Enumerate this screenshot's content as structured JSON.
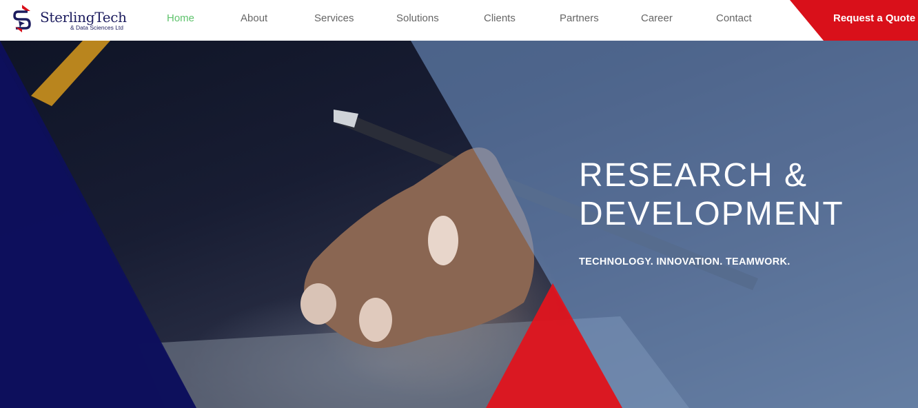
{
  "brand": {
    "name": "SterlingTech",
    "subtitle": "& Data Sciences Ltd"
  },
  "nav": {
    "items": [
      {
        "label": "Home",
        "active": true
      },
      {
        "label": "About"
      },
      {
        "label": "Services"
      },
      {
        "label": "Solutions"
      },
      {
        "label": "Clients"
      },
      {
        "label": "Partners"
      },
      {
        "label": "Career"
      },
      {
        "label": "Contact"
      }
    ],
    "cta": "Request a Quote"
  },
  "hero": {
    "title_line1": "RESEARCH &",
    "title_line2": "DEVELOPMENT",
    "tagline": "TECHNOLOGY. INNOVATION. TEAMWORK."
  },
  "colors": {
    "accent_red": "#d9101a",
    "navy": "#0d0f5c",
    "nav_active": "#5fc36d",
    "overlay_blue": "#7aa0d6"
  }
}
